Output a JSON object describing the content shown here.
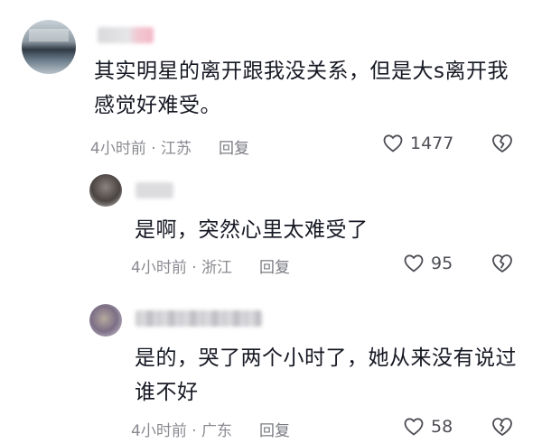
{
  "comments": [
    {
      "text": "其实明星的离开跟我没关系，但是大s离开我感觉好难受。",
      "time": "4小时前",
      "location": "江苏",
      "reply_label": "回复",
      "likes": "1477"
    }
  ],
  "replies": [
    {
      "text": "是啊，突然心里太难受了",
      "time": "4小时前",
      "location": "浙江",
      "reply_label": "回复",
      "likes": "95"
    },
    {
      "text": "是的，哭了两个小时了，她从来没有说过谁不好",
      "time": "4小时前",
      "location": "广东",
      "reply_label": "回复",
      "likes": "58"
    }
  ],
  "meta_separator": " · ",
  "icons": {
    "like": "heart-outline-icon",
    "dislike": "broken-heart-icon"
  },
  "colors": {
    "text": "#161823",
    "meta": "#8a8b91"
  }
}
